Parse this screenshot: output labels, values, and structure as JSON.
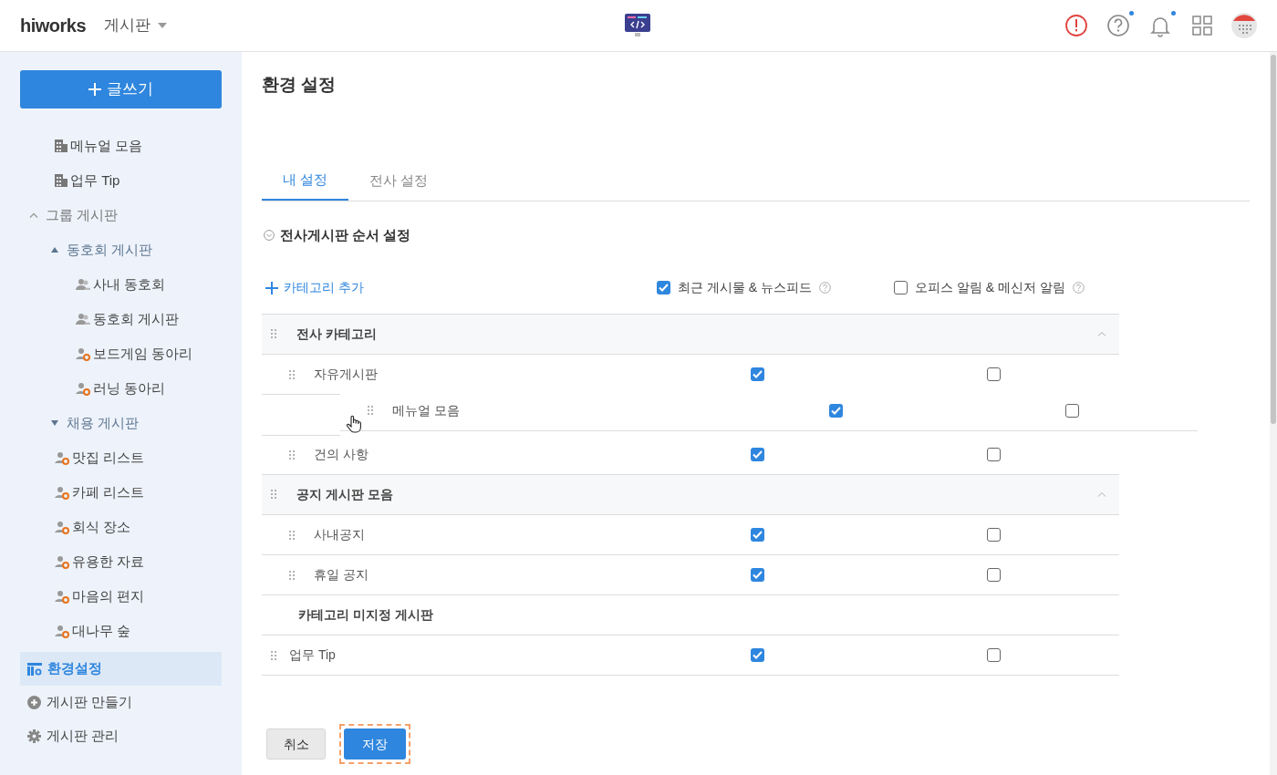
{
  "header": {
    "logo": "hiworks",
    "app_menu": "게시판",
    "icons": [
      {
        "kind": "alert"
      },
      {
        "kind": "help",
        "dot": true
      },
      {
        "kind": "notifications",
        "dot": true
      },
      {
        "kind": "apps"
      },
      {
        "kind": "avatar"
      }
    ]
  },
  "sidebar": {
    "write_button": "글쓰기",
    "items": [
      {
        "label": "메뉴얼 모음",
        "kind": "board"
      },
      {
        "label": "업무 Tip",
        "kind": "board"
      },
      {
        "label": "그룹 게시판",
        "kind": "section",
        "expanded": true,
        "children": [
          {
            "label": "동호회 게시판",
            "kind": "folder",
            "expanded": true,
            "children": [
              {
                "label": "사내 동호회",
                "kind": "group"
              },
              {
                "label": "동호회 게시판",
                "kind": "group"
              },
              {
                "label": "보드게임 동아리",
                "kind": "group-admin"
              },
              {
                "label": "러닝 동아리",
                "kind": "group-admin"
              }
            ]
          },
          {
            "label": "채용 게시판",
            "kind": "folder",
            "expanded": false
          },
          {
            "label": "맛집 리스트",
            "kind": "group-admin"
          },
          {
            "label": "카페 리스트",
            "kind": "group-admin"
          },
          {
            "label": "회식 장소",
            "kind": "group-admin"
          },
          {
            "label": "유용한 자료",
            "kind": "group-admin"
          },
          {
            "label": "마음의 편지",
            "kind": "group-admin"
          },
          {
            "label": "대나무 숲",
            "kind": "group-admin"
          }
        ]
      }
    ],
    "actions": [
      {
        "label": "환경설정",
        "kind": "settings",
        "selected": true
      },
      {
        "label": "게시판 만들기",
        "kind": "create",
        "selected": false
      },
      {
        "label": "게시판 관리",
        "kind": "manage",
        "selected": false
      }
    ]
  },
  "main": {
    "title": "환경 설정",
    "tabs": [
      {
        "label": "내 설정",
        "selected": true
      },
      {
        "label": "전사 설정",
        "selected": false
      }
    ],
    "section_title": "전사게시판 순서 설정",
    "add_category": "카테고리 추가",
    "columns": [
      {
        "label": "최근 게시물 & 뉴스피드",
        "checked": true
      },
      {
        "label": "오피스 알림 & 메신저 알림",
        "checked": false
      }
    ],
    "groups": [
      {
        "name": "전사 카테고리",
        "kind": "category",
        "expanded": true,
        "boards": [
          {
            "name": "자유게시판",
            "recent": true,
            "notify": false,
            "dragging": false
          },
          {
            "name": "메뉴얼 모음",
            "recent": true,
            "notify": false,
            "dragging": true
          },
          {
            "name": "건의 사항",
            "recent": true,
            "notify": false,
            "dragging": false
          }
        ]
      },
      {
        "name": "공지 게시판 모음",
        "kind": "category",
        "expanded": true,
        "boards": [
          {
            "name": "사내공지",
            "recent": true,
            "notify": false,
            "dragging": false
          },
          {
            "name": "휴일 공지",
            "recent": true,
            "notify": false,
            "dragging": false
          }
        ]
      },
      {
        "name": "카테고리 미지정 게시판",
        "kind": "uncategorized",
        "boards": [
          {
            "name": "업무 Tip",
            "recent": true,
            "notify": false,
            "dragging": false
          }
        ]
      }
    ],
    "buttons": [
      {
        "label": "취소",
        "kind": "cancel",
        "highlighted": false
      },
      {
        "label": "저장",
        "kind": "save",
        "highlighted": true
      }
    ]
  }
}
